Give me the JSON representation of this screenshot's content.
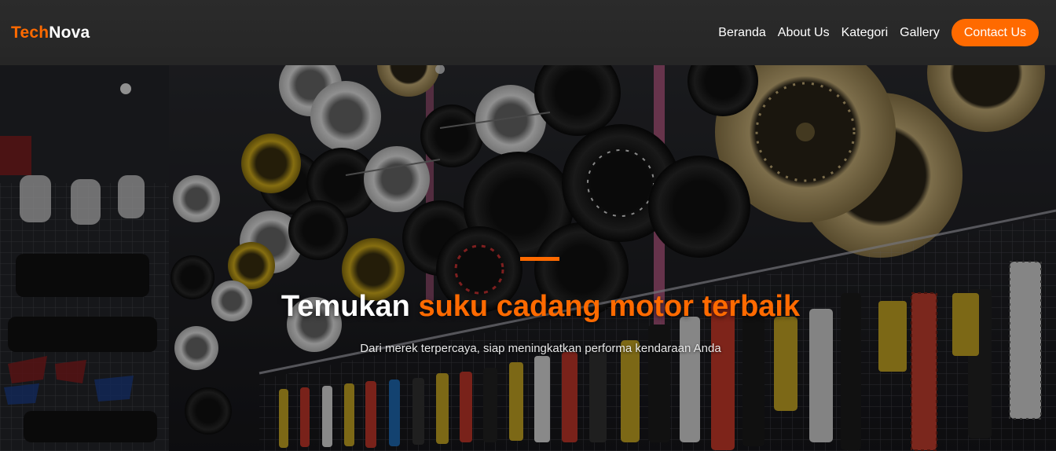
{
  "brand": {
    "part1": "Tech",
    "part2": "Nova"
  },
  "nav": {
    "items": [
      "Beranda",
      "About Us",
      "Kategori",
      "Gallery"
    ],
    "cta": "Contact Us"
  },
  "hero": {
    "title_plain": "Temukan",
    "title_highlight": "suku cadang motor terbaik",
    "subtitle": "Dari merek terpercaya, siap meningkatkan performa kendaraan Anda"
  },
  "colors": {
    "accent": "#ff6a00",
    "navbar": "#2a2a2a",
    "text": "#ffffff"
  }
}
